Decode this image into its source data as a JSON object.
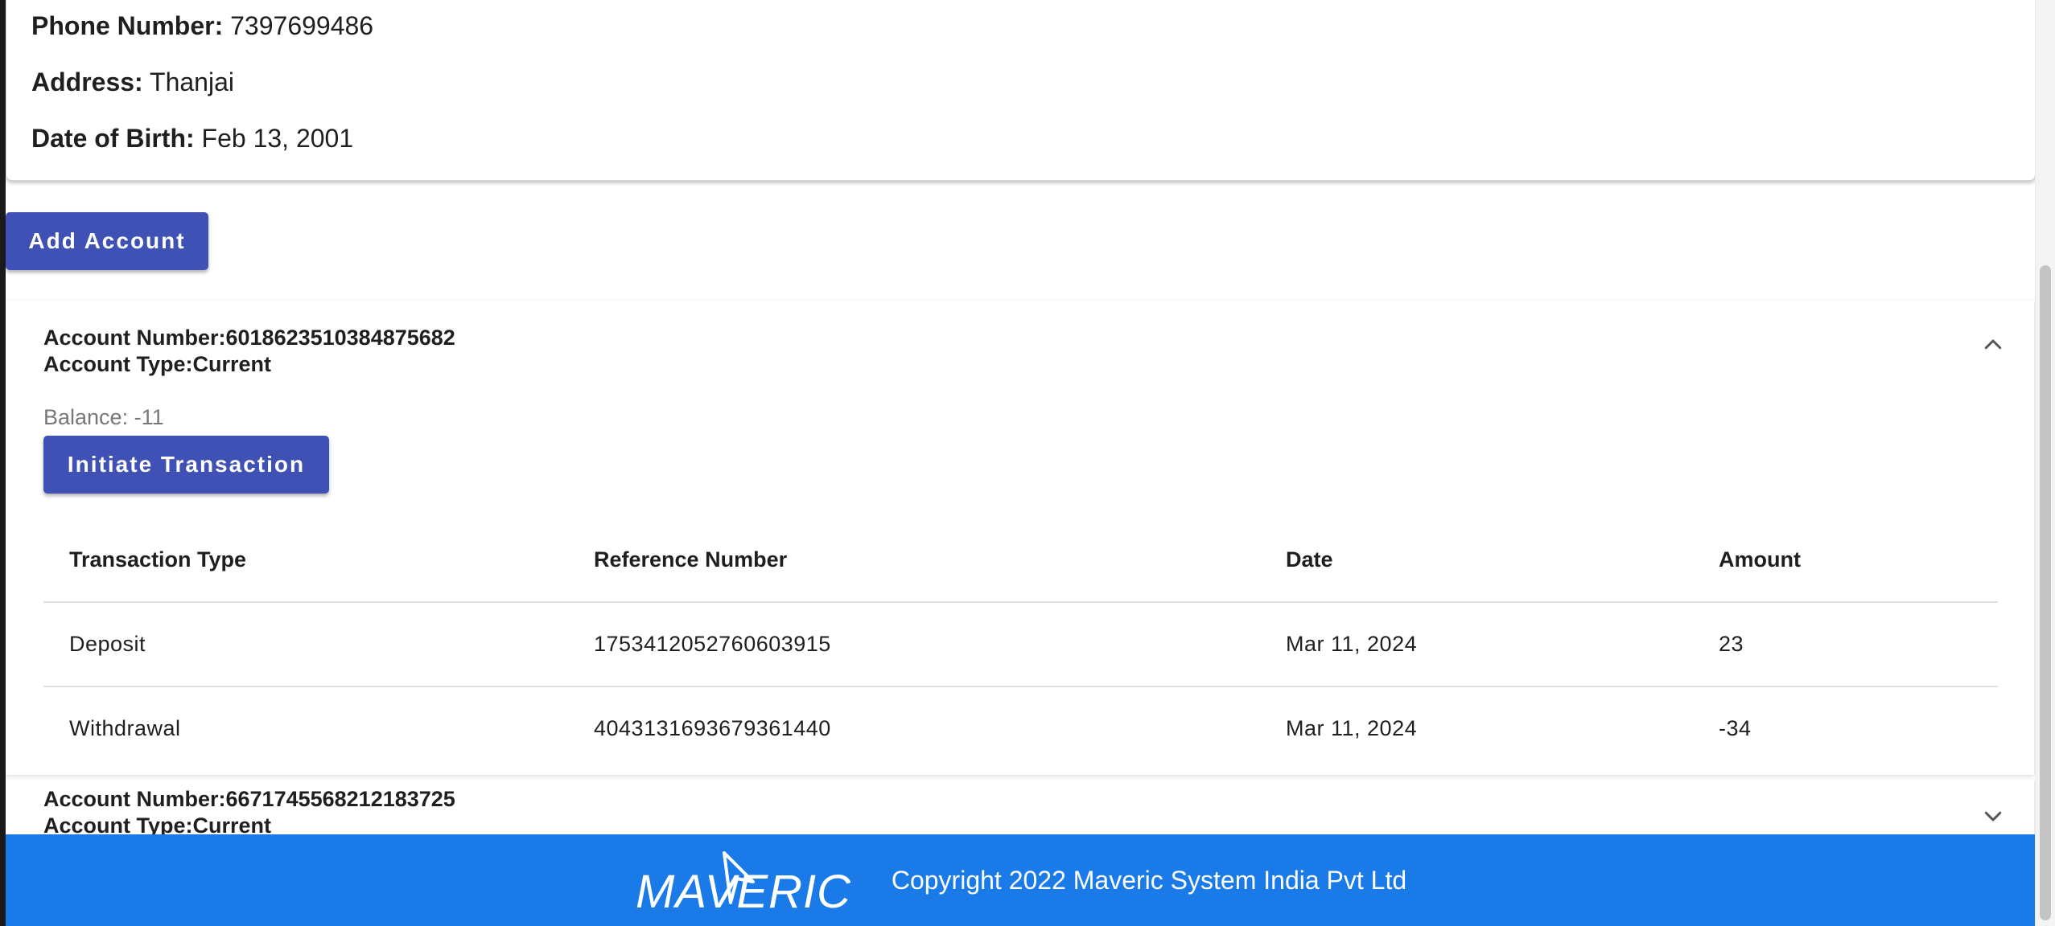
{
  "profile": {
    "phone_label": "Phone Number:",
    "phone_value": "7397699486",
    "address_label": "Address:",
    "address_value": "Thanjai",
    "dob_label": "Date of Birth:",
    "dob_value": "Feb 13, 2001"
  },
  "actions": {
    "add_account_label": "Add Account"
  },
  "accounts": [
    {
      "number_line": "Account Number:6018623510384875682",
      "type_line": "Account Type:Current",
      "expanded": true,
      "chevron_icon": "chevron-up-icon",
      "balance_text": "Balance: -11",
      "initiate_label": "Initiate Transaction",
      "columns": [
        "Transaction Type",
        "Reference Number",
        "Date",
        "Amount"
      ],
      "transactions": [
        {
          "type": "Deposit",
          "reference": "1753412052760603915",
          "date": "Mar 11, 2024",
          "amount": "23"
        },
        {
          "type": "Withdrawal",
          "reference": "4043131693679361440",
          "date": "Mar 11, 2024",
          "amount": "-34"
        }
      ]
    },
    {
      "number_line": "Account Number:6671745568212183725",
      "type_line": "Account Type:Current",
      "expanded": false,
      "chevron_icon": "chevron-down-icon"
    }
  ],
  "footer": {
    "logo_text": "MAVERIC",
    "copyright": "Copyright 2022 Maveric System India Pvt Ltd",
    "background_color": "#1a7be8"
  },
  "theme": {
    "primary_button_color": "#3f51b5"
  }
}
